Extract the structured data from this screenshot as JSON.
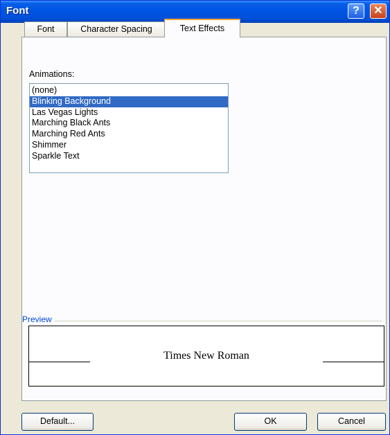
{
  "window": {
    "title": "Font",
    "help_glyph": "?",
    "close_glyph": "✕"
  },
  "tabs": [
    {
      "label": "Font",
      "active": false
    },
    {
      "label": "Character Spacing",
      "active": false
    },
    {
      "label": "Text Effects",
      "active": true
    }
  ],
  "animations": {
    "label": "Animations:",
    "items": [
      "(none)",
      "Blinking Background",
      "Las Vegas Lights",
      "Marching Black Ants",
      "Marching Red Ants",
      "Shimmer",
      "Sparkle Text"
    ],
    "selected": "Blinking Background"
  },
  "preview": {
    "label": "Preview",
    "sample_text": "Times New Roman"
  },
  "buttons": {
    "default": "Default...",
    "ok": "OK",
    "cancel": "Cancel"
  },
  "colors": {
    "titlebar": "#0054e3",
    "selection": "#316ac5",
    "active_tab_accent": "#f1a631",
    "preview_label": "#0046d5"
  }
}
